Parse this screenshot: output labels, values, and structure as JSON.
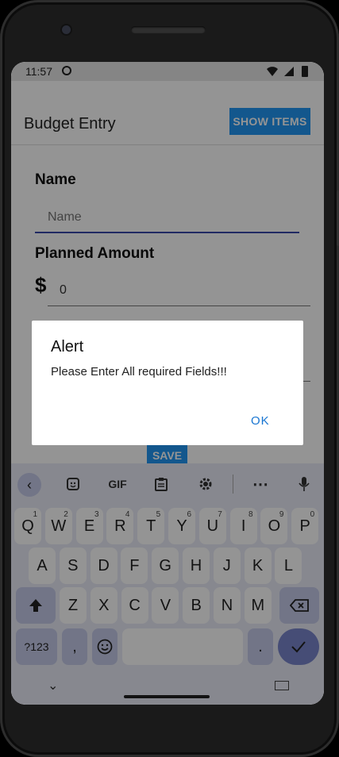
{
  "status_bar": {
    "time": "11:57",
    "icons": [
      "face-icon",
      "wifi-icon",
      "signal-icon",
      "battery-icon"
    ]
  },
  "app_bar": {
    "title": "Budget Entry",
    "show_items_label": "SHOW ITEMS"
  },
  "form": {
    "name_label": "Name",
    "name_placeholder": "Name",
    "name_value": "",
    "planned_label": "Planned Amount",
    "currency_symbol": "$",
    "amount_value": "0",
    "save_label": "SAVE"
  },
  "dialog": {
    "title": "Alert",
    "message": "Please Enter All required Fields!!!",
    "ok_label": "OK"
  },
  "keyboard": {
    "toolbar": [
      "back-icon",
      "sticker-icon",
      "GIF",
      "clipboard-icon",
      "gear-icon",
      "more-icon",
      "microphone-icon"
    ],
    "gif_label": "GIF",
    "row1": [
      {
        "k": "Q",
        "h": "1"
      },
      {
        "k": "W",
        "h": "2"
      },
      {
        "k": "E",
        "h": "3"
      },
      {
        "k": "R",
        "h": "4"
      },
      {
        "k": "T",
        "h": "5"
      },
      {
        "k": "Y",
        "h": "6"
      },
      {
        "k": "U",
        "h": "7"
      },
      {
        "k": "I",
        "h": "8"
      },
      {
        "k": "O",
        "h": "9"
      },
      {
        "k": "P",
        "h": "0"
      }
    ],
    "row2": [
      "A",
      "S",
      "D",
      "F",
      "G",
      "H",
      "J",
      "K",
      "L"
    ],
    "row3": [
      "Z",
      "X",
      "C",
      "V",
      "B",
      "N",
      "M"
    ],
    "symbols_label": "?123",
    "comma_label": ",",
    "period_label": "."
  },
  "colors": {
    "primary": "#2196f3",
    "dialog_button": "#1976d2",
    "underline": "#3949ab",
    "keyboard_bg": "#e8eaf6"
  }
}
